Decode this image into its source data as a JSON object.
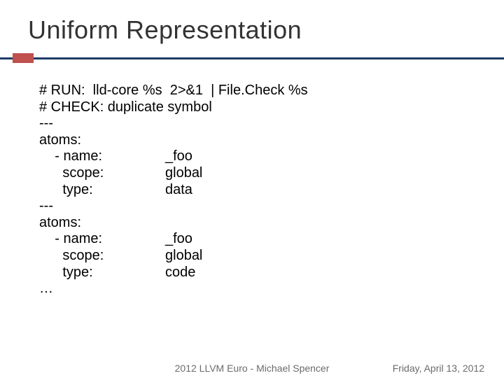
{
  "title": "Uniform Representation",
  "code": {
    "run": "# RUN:  lld-core %s  2>&1  | File.Check %s",
    "check": "# CHECK: duplicate symbol",
    "sep": "---",
    "atoms_label": "atoms:",
    "name_key": "    - name:",
    "scope_key": "      scope:",
    "type_key": "      type:",
    "block1": {
      "name": "_foo",
      "scope": "global",
      "type": "data"
    },
    "block2": {
      "name": "_foo",
      "scope": "global",
      "type": "code"
    },
    "ellipsis": "…"
  },
  "footer": {
    "center": "2012 LLVM Euro - Michael Spencer",
    "right": "Friday, April 13, 2012"
  }
}
